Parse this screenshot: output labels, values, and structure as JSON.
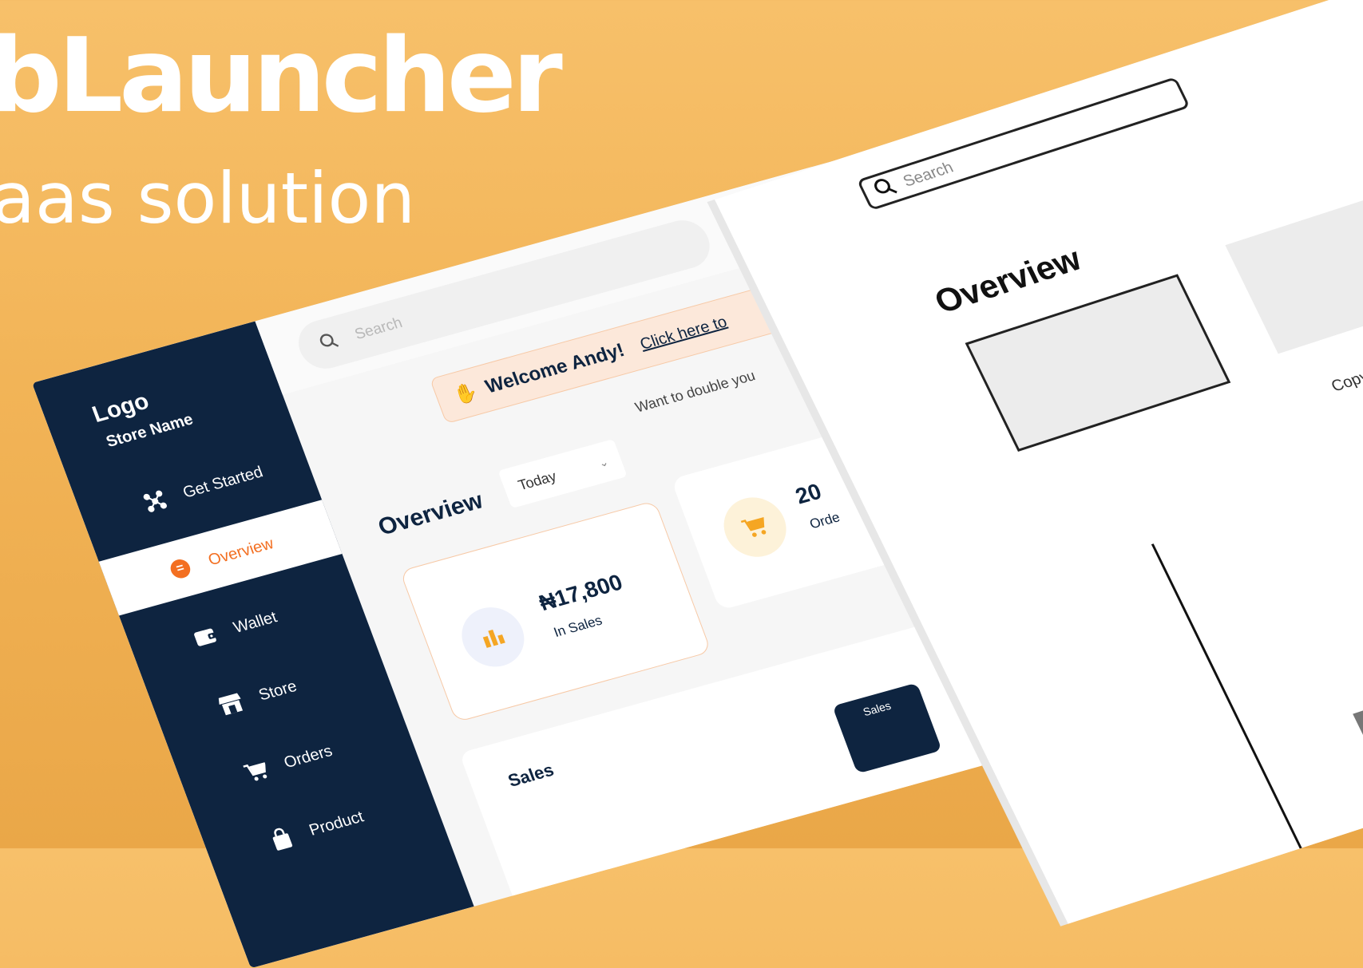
{
  "hero": {
    "title": "bLauncher",
    "subtitle": "aas solution"
  },
  "dashboard": {
    "sidebar": {
      "logo": "Logo",
      "store_name": "Store Name",
      "items": [
        {
          "label": "Get Started",
          "icon": "network-icon"
        },
        {
          "label": "Overview",
          "icon": "overview-icon",
          "active": true
        },
        {
          "label": "Wallet",
          "icon": "wallet-icon"
        },
        {
          "label": "Store",
          "icon": "store-icon"
        },
        {
          "label": "Orders",
          "icon": "cart-icon"
        },
        {
          "label": "Product",
          "icon": "bag-icon"
        }
      ]
    },
    "search": {
      "placeholder": "Search"
    },
    "welcome": {
      "wave_icon": "waving-hand-icon",
      "text": "Welcome Andy!",
      "link": "Click here to"
    },
    "promo_text": "Want to double you",
    "overview": {
      "title": "Overview",
      "period": "Today"
    },
    "cards": [
      {
        "amount": "₦17,800",
        "label": "In Sales",
        "icon": "bar-chart-icon"
      },
      {
        "amount": "20",
        "label": "Orde",
        "icon": "cart-icon"
      }
    ],
    "sales_panel": {
      "title": "Sales",
      "tag": "Sales"
    },
    "colors": {
      "navy": "#0e2440",
      "orange": "#f36f21",
      "amber": "#f5a623",
      "background": "#f2b457"
    }
  },
  "wireframe": {
    "search": {
      "placeholder": "Search"
    },
    "title": "Overview",
    "copy_text": "Copy for marketing"
  }
}
